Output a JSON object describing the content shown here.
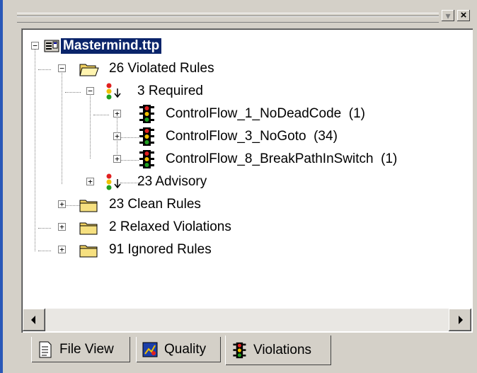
{
  "window": {
    "titlebar": {
      "dropdown_icon": "chevron-down-icon",
      "close_icon": "close-icon",
      "close_glyph": "×",
      "dropdown_glyph": "▾"
    }
  },
  "tree": {
    "root": {
      "label": "Mastermind.ttp",
      "icon": "project-icon",
      "expanded": true,
      "selected": true
    },
    "violated": {
      "label": "26 Violated Rules",
      "icon": "folder-open-icon",
      "expanded": true
    },
    "required": {
      "label": "3 Required",
      "icon": "priority-icon",
      "expanded": true
    },
    "rules": [
      {
        "label": "ControlFlow_1_NoDeadCode  (1)",
        "icon": "traffic-light-icon"
      },
      {
        "label": "ControlFlow_3_NoGoto  (34)",
        "icon": "traffic-light-icon"
      },
      {
        "label": "ControlFlow_8_BreakPathInSwitch  (1)",
        "icon": "traffic-light-icon"
      }
    ],
    "advisory": {
      "label": "23 Advisory",
      "icon": "priority-icon",
      "expanded": false
    },
    "folders": [
      {
        "label": "23 Clean Rules",
        "icon": "folder-icon"
      },
      {
        "label": "2 Relaxed Violations",
        "icon": "folder-icon"
      },
      {
        "label": "91 Ignored Rules",
        "icon": "folder-icon"
      }
    ],
    "expand_glyph": "+",
    "collapse_glyph": "−"
  },
  "tabs": [
    {
      "label": "File View",
      "icon": "file-view-icon",
      "active": false
    },
    {
      "label": "Quality",
      "icon": "quality-icon",
      "active": false
    },
    {
      "label": "Violations",
      "icon": "traffic-light-icon",
      "active": true
    }
  ],
  "colors": {
    "selection": "#0a246a",
    "folder": "#f0d060",
    "light_red": "#e02020",
    "light_yellow": "#f0c000",
    "light_green": "#20a020"
  }
}
